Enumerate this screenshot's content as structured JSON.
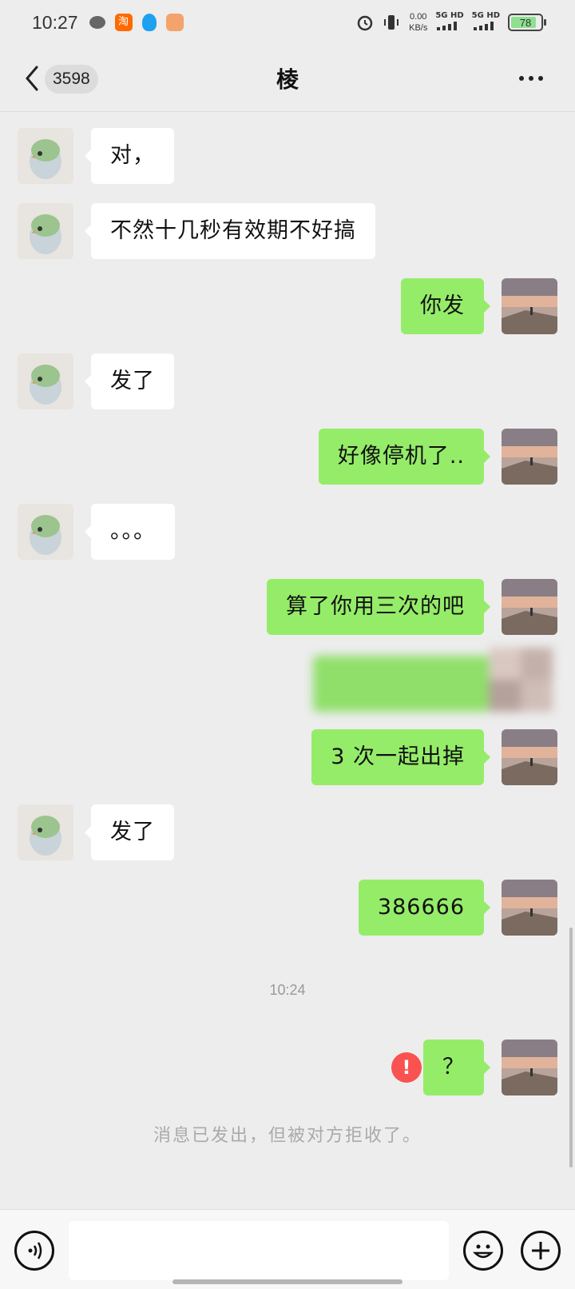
{
  "status_bar": {
    "time": "10:27",
    "apps": [
      "wechat-icon",
      "taobao-icon",
      "qq-icon",
      "notification-app-icon"
    ],
    "taobao_glyph": "淘",
    "speed_value": "0.00",
    "speed_unit": "KB/s",
    "network_1": "5G HD",
    "network_2": "5G HD",
    "battery": "78",
    "battery_level": 0.78
  },
  "header": {
    "unread_count": "3598",
    "title": "棱"
  },
  "messages": [
    {
      "side": "left",
      "text": "对，"
    },
    {
      "side": "left",
      "text": "不然十几秒有效期不好搞"
    },
    {
      "side": "right",
      "text": "你发"
    },
    {
      "side": "left",
      "text": "发了"
    },
    {
      "side": "right",
      "text": "好像停机了.."
    },
    {
      "side": "left",
      "text": "。。。"
    },
    {
      "side": "right",
      "text": "算了你用三次的吧"
    },
    {
      "side": "right",
      "text": "3 次一起出掉"
    },
    {
      "side": "left",
      "text": "发了"
    },
    {
      "side": "right",
      "text": "386666"
    },
    {
      "side": "right",
      "text": "？"
    }
  ],
  "time_divider": "10:24",
  "failed_message_icon": "!",
  "system_notice": "消息已发出，但被对方拒收了。",
  "colors": {
    "background": "#ededed",
    "outgoing_bubble": "#95ec69",
    "incoming_bubble": "#ffffff",
    "error": "#fa5151"
  }
}
